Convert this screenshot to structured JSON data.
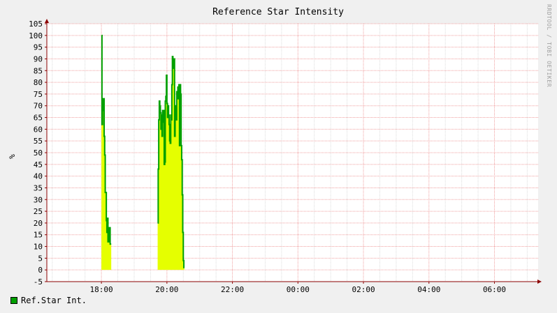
{
  "chart_data": {
    "type": "area",
    "title": "Reference Star Intensity",
    "xlabel": "",
    "ylabel": "%",
    "ylim": [
      -5,
      105
    ],
    "y_ticks": [
      -5,
      0,
      5,
      10,
      15,
      20,
      25,
      30,
      35,
      40,
      45,
      50,
      55,
      60,
      65,
      70,
      75,
      80,
      85,
      90,
      95,
      100,
      105
    ],
    "y_tick_labels": [
      "-5",
      "0",
      "5",
      "10",
      "15",
      "20",
      "25",
      "30",
      "35",
      "40",
      "45",
      "50",
      "55",
      "60",
      "65",
      "70",
      "75",
      "80",
      "85",
      "90",
      "95",
      "100",
      "105"
    ],
    "xlim": [
      "16:20",
      "07:20"
    ],
    "x_ticks": [
      "18:00",
      "20:00",
      "22:00",
      "00:00",
      "02:00",
      "04:00",
      "06:00"
    ],
    "grid": true,
    "legend_position": "bottom-left",
    "series": [
      {
        "name": "Ref.Star Int.",
        "area_color": "#e5ff00",
        "line_color": "#00a000",
        "points": [
          [
            "18:00",
            100
          ],
          [
            "18:01",
            62
          ],
          [
            "18:02",
            73
          ],
          [
            "18:03",
            68
          ],
          [
            "18:04",
            73
          ],
          [
            "18:05",
            57
          ],
          [
            "18:06",
            49
          ],
          [
            "18:07",
            33
          ],
          [
            "18:08",
            33
          ],
          [
            "18:09",
            21
          ],
          [
            "18:10",
            16
          ],
          [
            "18:11",
            22
          ],
          [
            "18:12",
            12
          ],
          [
            "18:13",
            18
          ],
          [
            "18:14",
            12
          ],
          [
            "18:15",
            18
          ],
          [
            "18:16",
            11
          ],
          [
            "18:17",
            11
          ],
          [
            "19:43",
            20
          ],
          [
            "19:44",
            43
          ],
          [
            "19:45",
            64
          ],
          [
            "19:46",
            72
          ],
          [
            "19:47",
            70
          ],
          [
            "19:48",
            67
          ],
          [
            "19:49",
            60
          ],
          [
            "19:50",
            66
          ],
          [
            "19:51",
            57
          ],
          [
            "19:52",
            68
          ],
          [
            "19:53",
            63
          ],
          [
            "19:54",
            68
          ],
          [
            "19:55",
            45
          ],
          [
            "19:56",
            46
          ],
          [
            "19:57",
            72
          ],
          [
            "19:58",
            74
          ],
          [
            "19:59",
            83
          ],
          [
            "20:00",
            71
          ],
          [
            "20:01",
            65
          ],
          [
            "20:02",
            70
          ],
          [
            "20:03",
            66
          ],
          [
            "20:04",
            62
          ],
          [
            "20:05",
            55
          ],
          [
            "20:06",
            54
          ],
          [
            "20:07",
            66
          ],
          [
            "20:08",
            64
          ],
          [
            "20:09",
            79
          ],
          [
            "20:10",
            91
          ],
          [
            "20:11",
            86
          ],
          [
            "20:12",
            86
          ],
          [
            "20:13",
            90
          ],
          [
            "20:14",
            57
          ],
          [
            "20:15",
            70
          ],
          [
            "20:16",
            67
          ],
          [
            "20:17",
            64
          ],
          [
            "20:18",
            76
          ],
          [
            "20:19",
            73
          ],
          [
            "20:20",
            78
          ],
          [
            "20:21",
            73
          ],
          [
            "20:22",
            79
          ],
          [
            "20:23",
            53
          ],
          [
            "20:24",
            79
          ],
          [
            "20:25",
            75
          ],
          [
            "20:26",
            53
          ],
          [
            "20:27",
            47
          ],
          [
            "20:28",
            32
          ],
          [
            "20:29",
            16
          ],
          [
            "20:30",
            4
          ],
          [
            "20:31",
            1
          ]
        ]
      }
    ]
  },
  "watermark": "RRDTOOL / TOBI OETIKER",
  "colors": {
    "background": "#f0f0f0",
    "canvas": "#ffffff",
    "grid_minor": "#dcdcdc",
    "grid_major": "#f0a0a0",
    "axis": "#8b0000"
  }
}
